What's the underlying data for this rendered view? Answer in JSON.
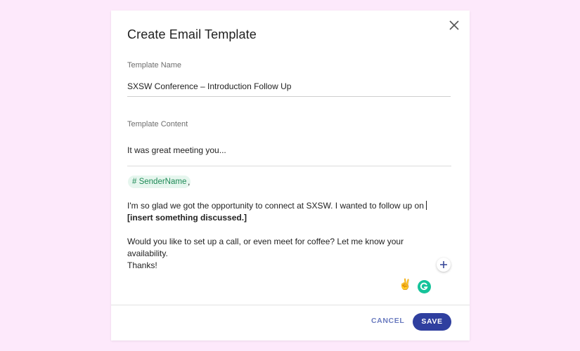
{
  "dialog": {
    "title": "Create Email Template"
  },
  "template_name": {
    "label": "Template Name",
    "value": "SXSW Conference – Introduction Follow Up"
  },
  "template_content": {
    "label": "Template Content",
    "subject": "It was great meeting you...",
    "sender_chip": "# SenderName",
    "comma": ",",
    "paragraph1_plain": "I'm so glad we got the opportunity to connect at SXSW. I wanted to follow up on ",
    "paragraph1_bold": "[insert something discussed.]",
    "paragraph2": "Would you like to set up a call, or even meet for coffee? Let me know your availability.",
    "paragraph3": "Thanks!"
  },
  "icons": {
    "close": "close-icon",
    "add": "plus-icon",
    "emoji": "victory-hand-emoji",
    "grammarly": "grammarly-icon"
  },
  "emoji_glyph": "✌",
  "footer": {
    "cancel_label": "CANCEL",
    "save_label": "SAVE"
  },
  "colors": {
    "background": "#fde9fb",
    "accent": "#2f3f9f",
    "chip_text": "#1e8a56",
    "chip_bg": "#e6f6ee",
    "grammarly": "#15c39a"
  }
}
